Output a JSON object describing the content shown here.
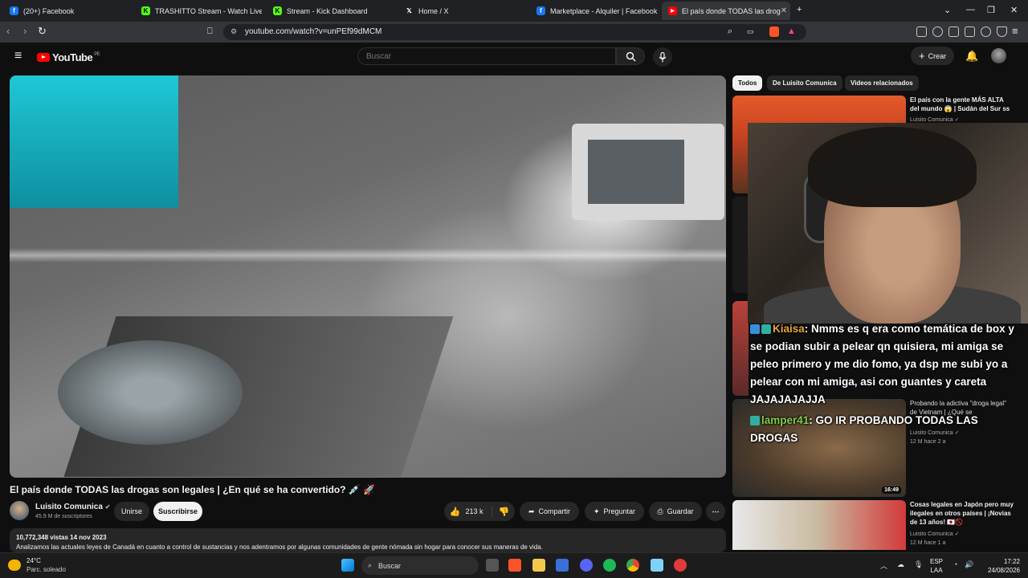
{
  "browser": {
    "tabs": [
      {
        "label": "(20+) Facebook",
        "icon": "facebook-icon"
      },
      {
        "label": "TRASHITTO Stream - Watch Live on K",
        "icon": "kick-icon"
      },
      {
        "label": "Stream - Kick Dashboard",
        "icon": "kick-icon"
      },
      {
        "label": "Home / X",
        "icon": "x-icon"
      },
      {
        "label": "Marketplace - Alquiler | Facebook",
        "icon": "facebook-icon"
      },
      {
        "label": "El país donde TODAS las drog",
        "icon": "youtube-icon"
      }
    ],
    "new_tab": "+",
    "url": "youtube.com/watch?v=unPEf99dMCM"
  },
  "youtube": {
    "logo": "YouTube",
    "region": "PE",
    "search_placeholder": "Buscar",
    "create_label": "Crear"
  },
  "video": {
    "title": "El país donde TODAS las drogas son legales | ¿En qué se ha convertido? 💉 🚀",
    "channel": "Luisito Comunica",
    "subscribers": "45.9 M de suscriptores",
    "join_label": "Unirse",
    "subscribe_label": "Suscribirse",
    "likes": "213 k",
    "share_label": "Compartir",
    "ask_label": "Preguntar",
    "save_label": "Guardar",
    "views_date": "10,772,348 vistas  14 nov 2023",
    "description": "Analizamos las actuales leyes de Canadá en cuanto a control de sustancias y nos adentramos por algunas comunidades de gente nómada sin hogar para conocer sus maneras de vida."
  },
  "chips": [
    "Todos",
    "De Luisito Comunica",
    "Videos relacionados"
  ],
  "recommendations": [
    {
      "title": "El país con la gente MÁS ALTA del mundo 😱 | Sudán del Sur ss",
      "channel": "Luisito Comunica ✓",
      "meta": ""
    },
    {
      "title": "Probando la adictiva \"droga legal\" de Vietnam | ¿Qué se",
      "channel": "Luisito Comunica ✓",
      "meta": "12 M   hace 2 a",
      "duration": "16:49"
    },
    {
      "title": "Cosas legales en Japón pero muy ilegales en otros países | ¡Novias de 13 años! 🇯🇵🚫",
      "channel": "Luisito Comunica ✓",
      "meta": "12 M   hace 1 a"
    }
  ],
  "chat": [
    {
      "user": "Kiaisa",
      "message": ": Nmms es q era como temática de box y se podian subir a pelear qn quisiera, mi amiga se peleo primero y me dio fomo, ya dsp me subi yo a pelear con mi amiga, asi con guantes y careta JAJAJAJAJJA"
    },
    {
      "user": "lamper41",
      "message": ": GO IR PROBANDO TODAS LAS DROGAS"
    }
  ],
  "taskbar": {
    "temp": "24°C",
    "weather": "Parc. soleado",
    "search": "Buscar",
    "lang1": "ESP",
    "lang2": "LAA",
    "time": "17:22",
    "date": "24/08/2026"
  },
  "colors": {
    "youtube_red": "#ff0000",
    "chat_user1": "#e8a43a",
    "chat_user2": "#7ecf4a"
  }
}
